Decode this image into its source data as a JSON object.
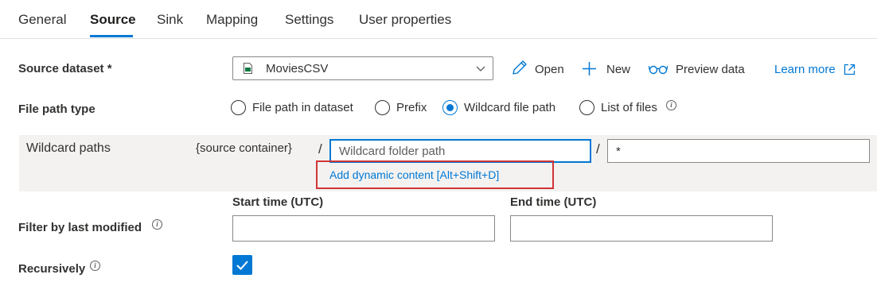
{
  "tabs": [
    {
      "label": "General"
    },
    {
      "label": "Source"
    },
    {
      "label": "Sink"
    },
    {
      "label": "Mapping"
    },
    {
      "label": "Settings"
    },
    {
      "label": "User properties"
    }
  ],
  "active_tab": "Source",
  "source_dataset": {
    "label": "Source dataset *",
    "value": "MoviesCSV",
    "actions": {
      "open": "Open",
      "new": "New",
      "preview": "Preview data",
      "learn_more": "Learn more"
    }
  },
  "file_path_type": {
    "label": "File path type",
    "options": [
      "File path in dataset",
      "Prefix",
      "Wildcard file path",
      "List of files"
    ],
    "selected": "Wildcard file path"
  },
  "wildcard_paths": {
    "label": "Wildcard paths",
    "container": "{source container}",
    "separator": "/",
    "folder_placeholder": "Wildcard folder path",
    "file_value": "*",
    "dynamic_content_link": "Add dynamic content [Alt+Shift+D]"
  },
  "filter_last_modified": {
    "label": "Filter by last modified",
    "start_label": "Start time (UTC)",
    "end_label": "End time (UTC)",
    "start_value": "",
    "end_value": ""
  },
  "recursively": {
    "label": "Recursively",
    "checked": true
  },
  "colors": {
    "accent": "#0078d4",
    "highlight_border": "#d13438",
    "panel_bg": "#f3f2f1"
  }
}
